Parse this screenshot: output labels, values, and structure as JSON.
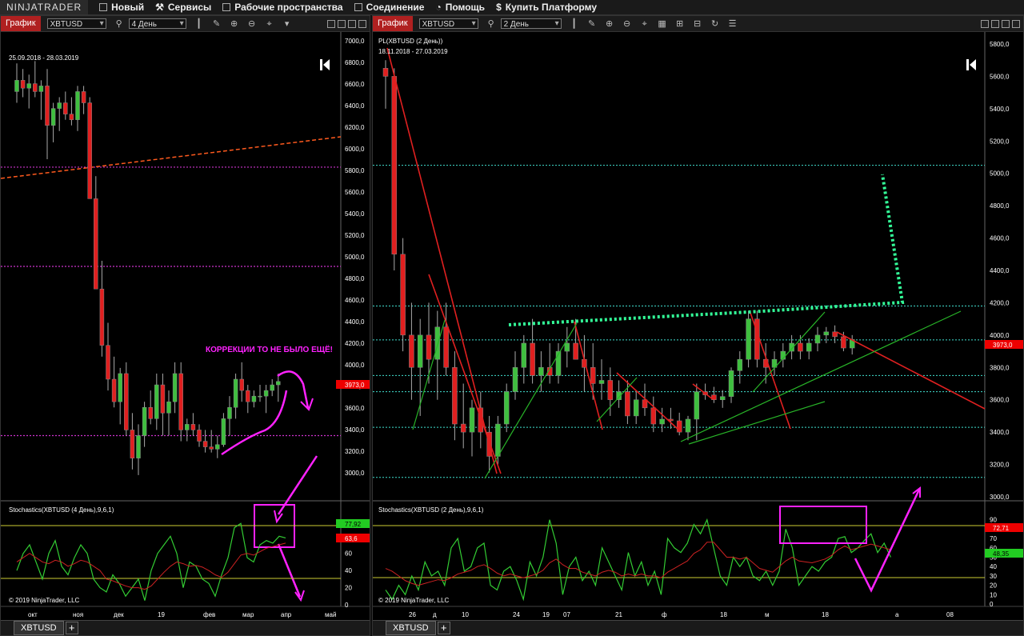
{
  "app": {
    "logo": "NINJATRADER",
    "menu": [
      "Новый",
      "Сервисы",
      "Рабочие пространства",
      "Соединение",
      "Помощь",
      "Купить Платформу"
    ]
  },
  "left": {
    "tab_label": "График",
    "instrument": "XBTUSD",
    "period": "4 День",
    "date_range": "25.09.2018 - 28.03.2019",
    "annotation": "КОРРЕКЦИИ ТО НЕ БЫЛО ЕЩЁ!",
    "price_labels": [
      "7000,0",
      "6800,0",
      "6600,0",
      "6400,0",
      "6200,0",
      "6000,0",
      "5800,0",
      "5600,0",
      "5400,0",
      "5200,0",
      "5000,0",
      "4800,0",
      "4600,0",
      "4400,0",
      "4200,0",
      "4000,0",
      "3800,0",
      "3600,0",
      "3400,0",
      "3200,0",
      "3000,0"
    ],
    "last_price": "3973,0",
    "stoch_title": "Stochastics(XBTUSD (4 День),9,6,1)",
    "stoch_labels": [
      "80",
      "60",
      "40",
      "20",
      "0"
    ],
    "stoch_k": "77,92",
    "stoch_d": "63,6",
    "copyright": "© 2019 NinjaTrader, LLC",
    "x_labels": [
      "окт",
      "ноя",
      "дек",
      "19",
      "фев",
      "мар",
      "апр",
      "май"
    ],
    "bottom_tab": "XBTUSD"
  },
  "right": {
    "tab_label": "График",
    "instrument": "XBTUSD",
    "period": "2 День",
    "series_title": "PL(XBTUSD (2 День))",
    "date_range": "18.11.2018 - 27.03.2019",
    "price_labels": [
      "5800,0",
      "5600,0",
      "5400,0",
      "5200,0",
      "5000,0",
      "4800,0",
      "4600,0",
      "4400,0",
      "4200,0",
      "4000,0",
      "3800,0",
      "3600,0",
      "3400,0",
      "3200,0",
      "3000,0"
    ],
    "last_price": "3973,0",
    "stoch_title": "Stochastics(XBTUSD (2 День),9,6,1)",
    "stoch_labels": [
      "90",
      "80",
      "70",
      "60",
      "50",
      "40",
      "30",
      "20",
      "10",
      "0"
    ],
    "stoch_k": "72,71",
    "stoch_d": "48,35",
    "copyright": "© 2019 NinjaTrader, LLC",
    "x_labels": [
      "26",
      "д",
      "10",
      "24",
      "19",
      "07",
      "21",
      "ф",
      "18",
      "м",
      "18",
      "а",
      "08"
    ],
    "bottom_tab": "XBTUSD"
  },
  "colors": {
    "bull": "#3fbf3f",
    "bear": "#e02020",
    "annotation": "#ff22ff",
    "dots": "#33ff99",
    "level": "#40e0d0",
    "purple": "#cc33cc"
  }
}
